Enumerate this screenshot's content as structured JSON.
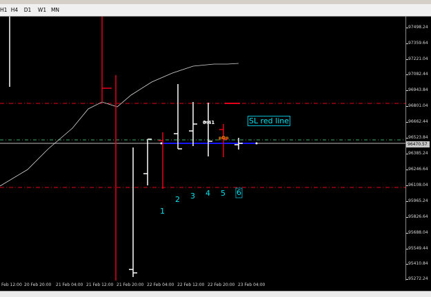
{
  "timeframes": [
    "H1",
    "H4",
    "D1",
    "W1",
    "MN"
  ],
  "price_scale": [
    "97498.24",
    "97359.64",
    "97221.04",
    "97082.44",
    "96943.84",
    "96801.04",
    "96662.44",
    "96523.84",
    "96385.24",
    "96246.64",
    "96108.04",
    "95965.24",
    "95826.64",
    "95688.04",
    "95549.44",
    "95410.84",
    "95272.24"
  ],
  "current_price": "96470.57",
  "time_scale": [
    "Feb 12:00",
    "20 Feb 20:00",
    "21 Feb 04:00",
    "21 Feb 12:00",
    "21 Feb 20:00",
    "22 Feb 04:00",
    "22 Feb 12:00",
    "22 Feb 20:00",
    "23 Feb 04:00"
  ],
  "annotations": {
    "sl_label": "SL red line",
    "value_top": "0.41",
    "value_pdn": "pDn",
    "counts": [
      "1",
      "2",
      "3",
      "4",
      "5",
      "6"
    ]
  },
  "colors": {
    "background": "#000000",
    "candle": "#ffffff",
    "red_line": "#e8001c",
    "blue_line": "#1515ff",
    "green_line": "#3cb371",
    "annotation": "#00e5ee",
    "ma_line": "#d8d8d8"
  }
}
